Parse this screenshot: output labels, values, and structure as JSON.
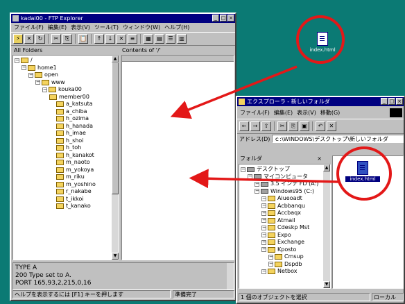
{
  "ftp": {
    "title": "kadai00 - FTP Explorer",
    "menu": [
      "ファイル(F)",
      "編集(E)",
      "表示(V)",
      "ツール(T)",
      "ウィンドウ(W)",
      "ヘルプ(H)"
    ],
    "left_header": "All Folders",
    "right_header": "Contents of '/'",
    "tree": [
      {
        "label": "/",
        "depth": 0
      },
      {
        "label": "home1",
        "depth": 1
      },
      {
        "label": "open",
        "depth": 2
      },
      {
        "label": "www",
        "depth": 3
      },
      {
        "label": "kouka00",
        "depth": 4
      },
      {
        "label": "member00",
        "depth": 5
      },
      {
        "label": "a_katsuta",
        "depth": 6
      },
      {
        "label": "a_chiba",
        "depth": 6
      },
      {
        "label": "h_ozima",
        "depth": 6
      },
      {
        "label": "h_hanada",
        "depth": 6
      },
      {
        "label": "h_imae",
        "depth": 6
      },
      {
        "label": "h_shoi",
        "depth": 6
      },
      {
        "label": "h_toh",
        "depth": 6
      },
      {
        "label": "h_kanakot",
        "depth": 6
      },
      {
        "label": "m_naoto",
        "depth": 6
      },
      {
        "label": "m_yokoya",
        "depth": 6
      },
      {
        "label": "m_riku",
        "depth": 6
      },
      {
        "label": "m_yoshino",
        "depth": 6
      },
      {
        "label": "r_nakabe",
        "depth": 6
      },
      {
        "label": "t_ikkoi",
        "depth": 6
      },
      {
        "label": "t_kanako",
        "depth": 6
      }
    ],
    "log_lines": [
      "TYPE A",
      "200 Type set to A.",
      "PORT 165,93,2,215,0,16"
    ],
    "status_left": "ヘルプを表示するには [F1] キーを押します",
    "status_right": "準備完了"
  },
  "explorer": {
    "title": "エクスプローラ - 新しいフォルダ",
    "menu": [
      "ファイル(F)",
      "編集(E)",
      "表示(V)",
      "移動(G)"
    ],
    "address_label": "アドレス(D)",
    "address_value": "ｃ:\\WINDOWS\\デスクトップ\\新しいフォルダ",
    "folders_header": "フォルダ",
    "tree": [
      {
        "label": "デスクトップ",
        "depth": 0,
        "kind": "drive"
      },
      {
        "label": "マイコンピュータ",
        "depth": 1,
        "kind": "drive"
      },
      {
        "label": "3.5 インチ FD (A:)",
        "depth": 2,
        "kind": "drive"
      },
      {
        "label": "Windows95 (C:)",
        "depth": 2,
        "kind": "drive"
      },
      {
        "label": "Aiueoadt",
        "depth": 3,
        "kind": "folder"
      },
      {
        "label": "Acbbanqu",
        "depth": 3,
        "kind": "folder"
      },
      {
        "label": "Accbaqx",
        "depth": 3,
        "kind": "folder"
      },
      {
        "label": "Atmail",
        "depth": 3,
        "kind": "folder"
      },
      {
        "label": "Cdeskp Mst",
        "depth": 3,
        "kind": "folder"
      },
      {
        "label": "Expo",
        "depth": 3,
        "kind": "folder"
      },
      {
        "label": "Exchange",
        "depth": 3,
        "kind": "folder"
      },
      {
        "label": "Kposto",
        "depth": 3,
        "kind": "folder"
      },
      {
        "label": "Cmsup",
        "depth": 4,
        "kind": "folder"
      },
      {
        "label": "Dspdb",
        "depth": 4,
        "kind": "folder"
      },
      {
        "label": "Netbox",
        "depth": 3,
        "kind": "folder"
      }
    ],
    "file_label": "index.html",
    "status_left": "1 個のオブジェクトを選択",
    "status_right": "ローカル"
  },
  "desktop_icon_label": "index.html",
  "colors": {
    "desktop": "#0b7a74",
    "titlebar": "#000080",
    "ring": "#e31818",
    "arrow": "#e31818"
  }
}
